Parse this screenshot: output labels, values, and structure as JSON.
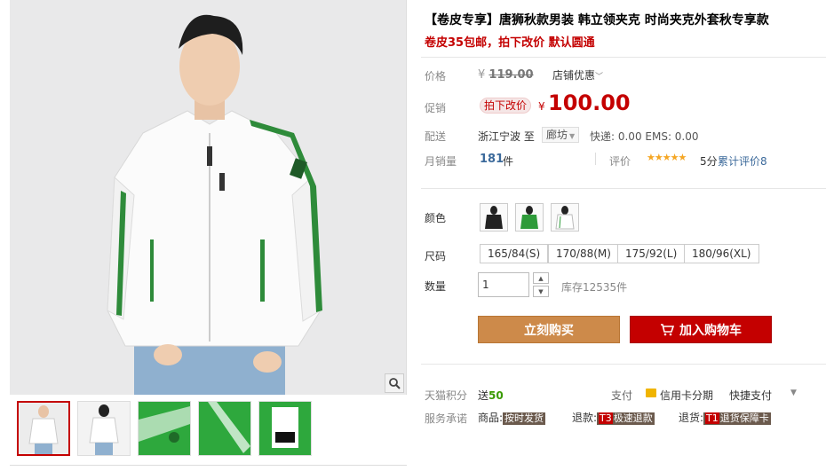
{
  "gallery": {
    "zoom_icon": "magnifier-icon",
    "thumbnails": [
      "front-white",
      "back-white",
      "green-detail-1",
      "green-detail-2",
      "tag-detail"
    ]
  },
  "product": {
    "title": "【卷皮专享】唐狮秋款男装 韩立领夹克 时尚夹克外套秋专享款",
    "subtitle": "卷皮35包邮，拍下改价 默认圆通"
  },
  "price": {
    "label": "价格",
    "yen": "¥",
    "old": "119.00",
    "store_promo": "店铺优惠",
    "promo_label": "促销",
    "promo_tag": "拍下改价",
    "new": "100.00"
  },
  "shipping": {
    "label": "配送",
    "from": "浙江宁波 至",
    "to": "廊坊",
    "fee": "快递: 0.00 EMS: 0.00"
  },
  "sales": {
    "label": "月销量",
    "count": "181",
    "unit": "件",
    "review_label": "评价",
    "stars": "★★★★★",
    "score": "5分",
    "review_count": "累计评价8"
  },
  "options": {
    "color_label": "颜色",
    "colors": [
      "black",
      "green",
      "white"
    ],
    "size_label": "尺码",
    "sizes": [
      "165/84(S)",
      "170/88(M)",
      "175/92(L)",
      "180/96(XL)"
    ],
    "qty_label": "数量",
    "qty_value": "1",
    "stock": "库存12535件"
  },
  "actions": {
    "buy_now": "立刻购买",
    "add_cart": "加入购物车"
  },
  "footer": {
    "points_label": "天猫积分",
    "points_prefix": "送",
    "points_value": "50",
    "pay_label": "支付",
    "credit": "信用卡分期",
    "fastpay": "快捷支付",
    "service_label": "服务承诺",
    "svc_goods_prefix": "商品:",
    "svc_goods": "按时发货",
    "svc_refund_prefix": "退款:",
    "svc_refund_code": "T3",
    "svc_refund": "极速退款",
    "svc_return_prefix": "退货:",
    "svc_return_code": "T1",
    "svc_return": "退货保障卡"
  },
  "colors": {
    "accent": "#c40000",
    "buy_button": "#cd8a4a",
    "link": "#3c6a9b",
    "green": "#2e9b3a"
  }
}
